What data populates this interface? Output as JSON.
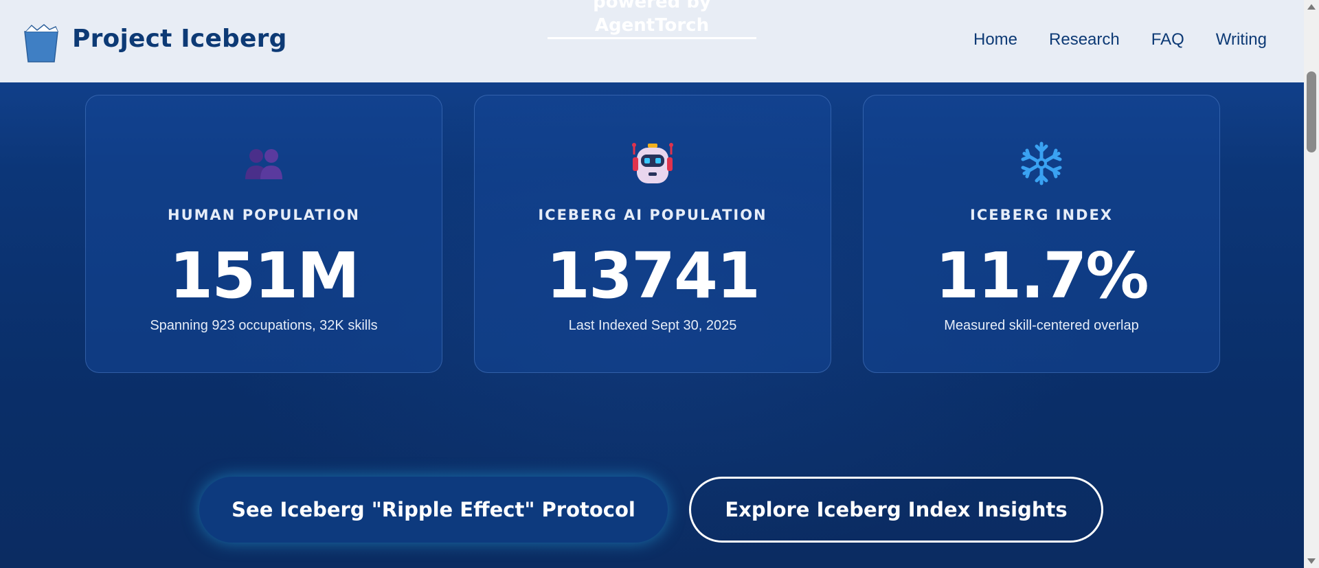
{
  "header": {
    "powered_by": "powered by AgentTorch",
    "brand": "Project Iceberg",
    "nav": [
      "Home",
      "Research",
      "FAQ",
      "Writing"
    ]
  },
  "cards": [
    {
      "icon": "people-icon",
      "label": "HUMAN POPULATION",
      "value": "151M",
      "sub": "Spanning 923 occupations, 32K skills"
    },
    {
      "icon": "robot-icon",
      "label": "ICEBERG AI POPULATION",
      "value": "13741",
      "sub": "Last Indexed Sept 30, 2025"
    },
    {
      "icon": "snowflake-icon",
      "label": "ICEBERG INDEX",
      "value": "11.7%",
      "sub": "Measured skill-centered overlap"
    }
  ],
  "buttons": {
    "primary": "See Iceberg \"Ripple Effect\" Protocol",
    "secondary": "Explore Iceberg Index Insights"
  },
  "colors": {
    "header_bg": "#e8edf5",
    "brand_text": "#0d3a75",
    "page_bg": "#0c3678",
    "card_bg": "#164696"
  }
}
